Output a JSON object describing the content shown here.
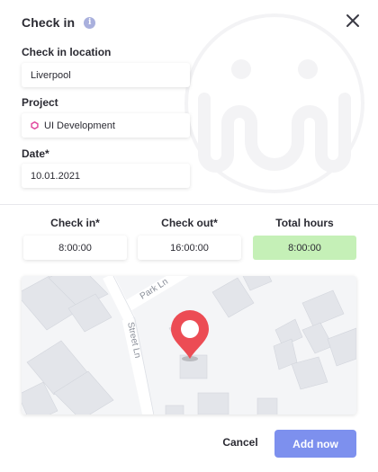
{
  "modal": {
    "title": "Check in",
    "info_icon": "info-icon",
    "close_icon": "close-icon",
    "watermark": "logo-watermark"
  },
  "fields": {
    "location": {
      "label": "Check in location",
      "value": "Liverpool"
    },
    "project": {
      "label": "Project",
      "value": "UI Development",
      "icon": "hexagon-icon",
      "icon_color": "#e0479e"
    },
    "date": {
      "label": "Date*",
      "value": "10.01.2021"
    }
  },
  "times": {
    "check_in": {
      "label": "Check in*",
      "value": "8:00:00"
    },
    "check_out": {
      "label": "Check out*",
      "value": "16:00:00"
    },
    "total": {
      "label": "Total hours",
      "value": "8:00:00",
      "color": "#c5f0b7"
    }
  },
  "map": {
    "streets": [
      "Park Ln",
      "Street Ln"
    ],
    "pin_icon": "map-pin-icon",
    "pin_color": "#ec4c54"
  },
  "actions": {
    "cancel_label": "Cancel",
    "add_label": "Add now",
    "add_color": "#7d90ee"
  }
}
